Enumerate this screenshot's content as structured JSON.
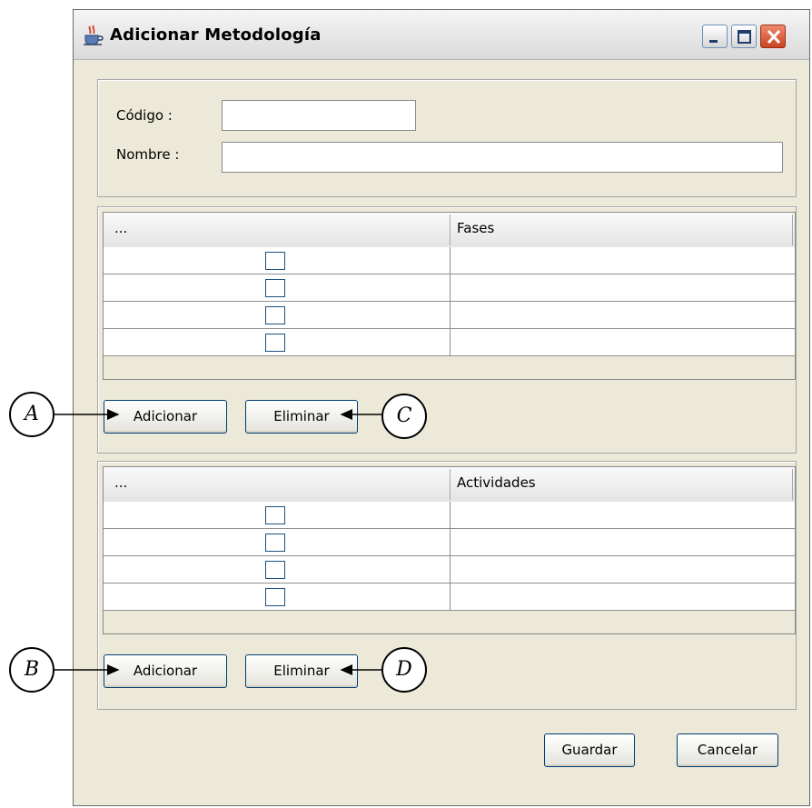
{
  "window": {
    "title": "Adicionar Metodología"
  },
  "form": {
    "codigo_label": "Código :",
    "codigo_value": "",
    "nombre_label": "Nombre :",
    "nombre_value": ""
  },
  "fases_table": {
    "col1_header": "...",
    "col2_header": "Fases",
    "rows": [
      {
        "checked": false,
        "value": ""
      },
      {
        "checked": false,
        "value": ""
      },
      {
        "checked": false,
        "value": ""
      },
      {
        "checked": false,
        "value": ""
      }
    ],
    "add_label": "Adicionar",
    "delete_label": "Eliminar"
  },
  "actividades_table": {
    "col1_header": "...",
    "col2_header": "Actividades",
    "rows": [
      {
        "checked": false,
        "value": ""
      },
      {
        "checked": false,
        "value": ""
      },
      {
        "checked": false,
        "value": ""
      },
      {
        "checked": false,
        "value": ""
      }
    ],
    "add_label": "Adicionar",
    "delete_label": "Eliminar"
  },
  "footer": {
    "save_label": "Guardar",
    "cancel_label": "Cancelar"
  },
  "annotations": {
    "a": "A",
    "b": "B",
    "c": "C",
    "d": "D"
  },
  "icons": {
    "title": "java-coffee-cup-icon",
    "minimize": "minimize-icon",
    "maximize": "maximize-icon",
    "close": "close-icon"
  },
  "colors": {
    "close_button": "#c8431f",
    "checkbox_border": "#1c5180",
    "window_bg": "#ece9d8"
  }
}
